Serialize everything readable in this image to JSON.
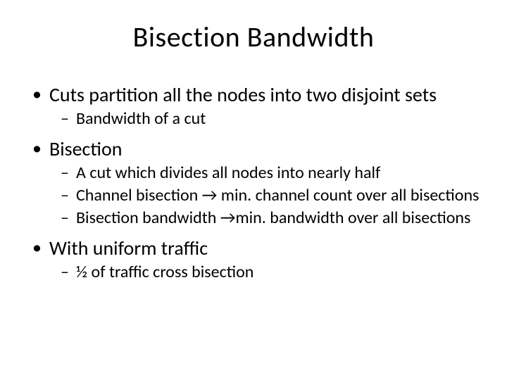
{
  "title": "Bisection Bandwidth",
  "bullets": [
    {
      "text": "Cuts partition all the nodes into two disjoint sets",
      "sub": [
        "Bandwidth of a cut"
      ]
    },
    {
      "text": "Bisection",
      "sub": [
        "A cut which divides all nodes into nearly half",
        "Channel bisection → min. channel count over all bisections",
        "Bisection bandwidth →min. bandwidth over all bisections"
      ]
    },
    {
      "text": "With uniform traffic",
      "sub": [
        "½ of traffic cross bisection"
      ]
    }
  ]
}
